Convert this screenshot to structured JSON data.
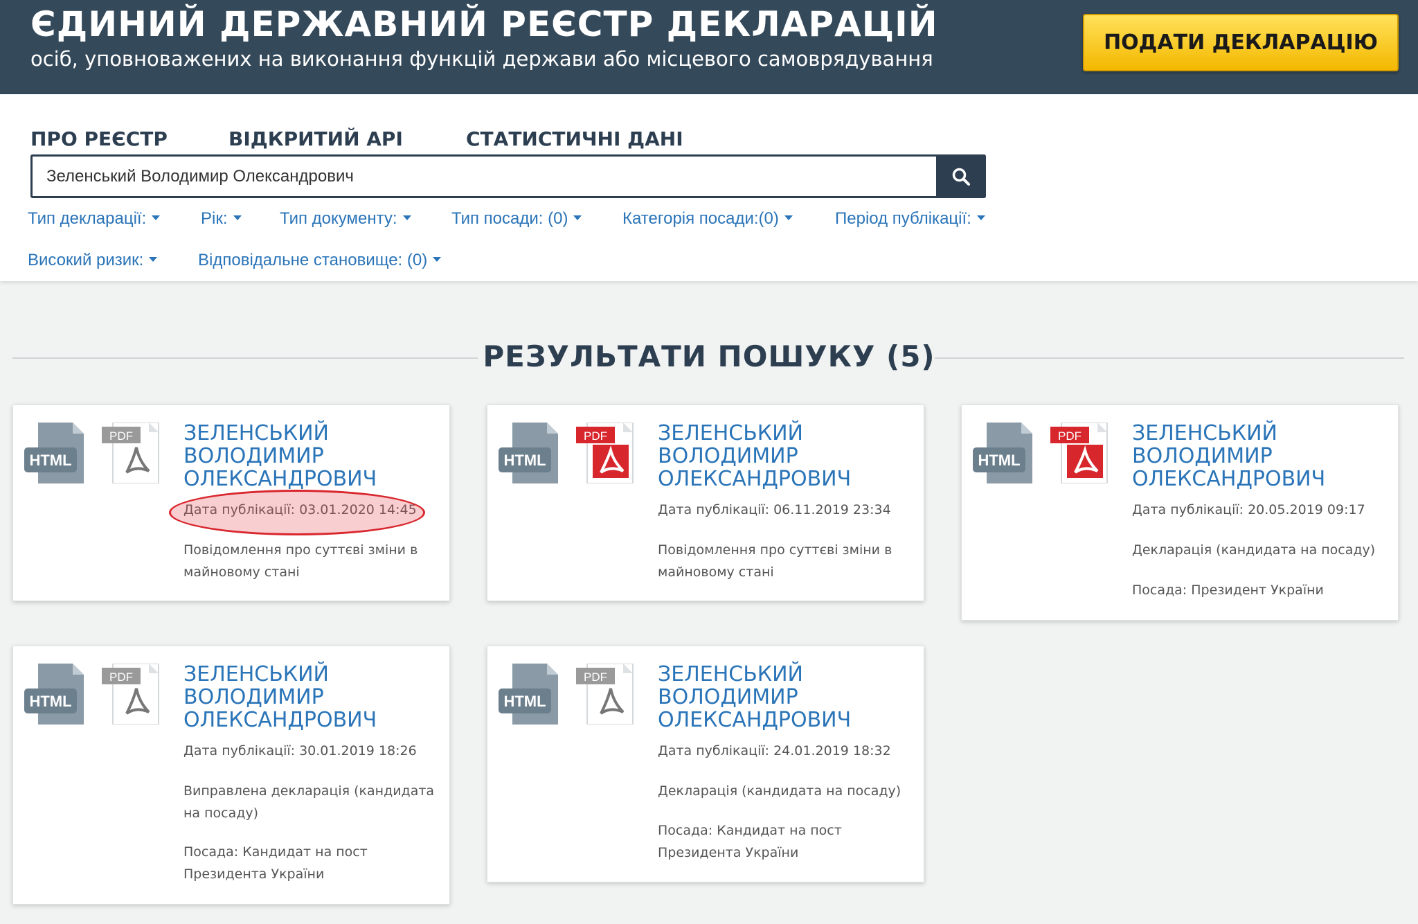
{
  "header": {
    "title": "ЄДИНИЙ ДЕРЖАВНИЙ РЕЄСТР ДЕКЛАРАЦІЙ",
    "subtitle": "осіб, уповноважених на виконання функцій держави або місцевого самоврядування",
    "submit_label": "ПОДАТИ ДЕКЛАРАЦІЮ"
  },
  "nav": {
    "about": "ПРО РЕЄСТР",
    "api": "ВІДКРИТИЙ API",
    "stats": "СТАТИСТИЧНІ ДАНІ"
  },
  "search": {
    "value": "Зеленський Володимир Олександрович",
    "icon": "search-icon"
  },
  "filters": {
    "declaration_type": "Тип декларації:",
    "year": "Рік:",
    "document_type": "Тип документу:",
    "position_type": "Тип посади: (0)",
    "position_category": "Категорія посади:(0)",
    "publication_period": "Період публікації:",
    "high_risk": "Високий ризик:",
    "responsible_position": "Відповідальне становище: (0)"
  },
  "results": {
    "heading": "РЕЗУЛЬТАТИ ПОШУКУ (5)",
    "cards": [
      {
        "name": "ЗЕЛЕНСЬКИЙ ВОЛОДИМИР ОЛЕКСАНДРОВИЧ",
        "date": "Дата публікації: 03.01.2020 14:45",
        "type": "Повідомлення про суттєві зміни в майновому стані",
        "position": "",
        "pdf_color": "gray",
        "highlighted": true
      },
      {
        "name": "ЗЕЛЕНСЬКИЙ ВОЛОДИМИР ОЛЕКСАНДРОВИЧ",
        "date": "Дата публікації: 06.11.2019 23:34",
        "type": "Повідомлення про суттєві зміни в майновому стані",
        "position": "",
        "pdf_color": "red",
        "highlighted": false
      },
      {
        "name": "ЗЕЛЕНСЬКИЙ ВОЛОДИМИР ОЛЕКСАНДРОВИЧ",
        "date": "Дата публікації: 20.05.2019 09:17",
        "type": "Декларація (кандидата на посаду)",
        "position": "Посада: Президент України",
        "pdf_color": "red",
        "highlighted": false
      },
      {
        "name": "ЗЕЛЕНСЬКИЙ ВОЛОДИМИР ОЛЕКСАНДРОВИЧ",
        "date": "Дата публікації: 30.01.2019 18:26",
        "type": "Виправлена декларація (кандидата на посаду)",
        "position": "Посада: Кандидат на пост Президента України",
        "pdf_color": "gray",
        "highlighted": false
      },
      {
        "name": "ЗЕЛЕНСЬКИЙ ВОЛОДИМИР ОЛЕКСАНДРОВИЧ",
        "date": "Дата публікації: 24.01.2019 18:32",
        "type": "Декларація (кандидата на посаду)",
        "position": "Посада: Кандидат на пост Президента України",
        "pdf_color": "gray",
        "highlighted": false
      }
    ]
  },
  "icon_labels": {
    "html": "HTML",
    "pdf": "PDF"
  },
  "colors": {
    "header_bg": "#34495a",
    "accent_blue": "#2a74b8",
    "button_yellow": "#f7c600",
    "pdf_red": "#d7262c",
    "pdf_gray": "#888888",
    "highlight_red": "#d9272e"
  }
}
